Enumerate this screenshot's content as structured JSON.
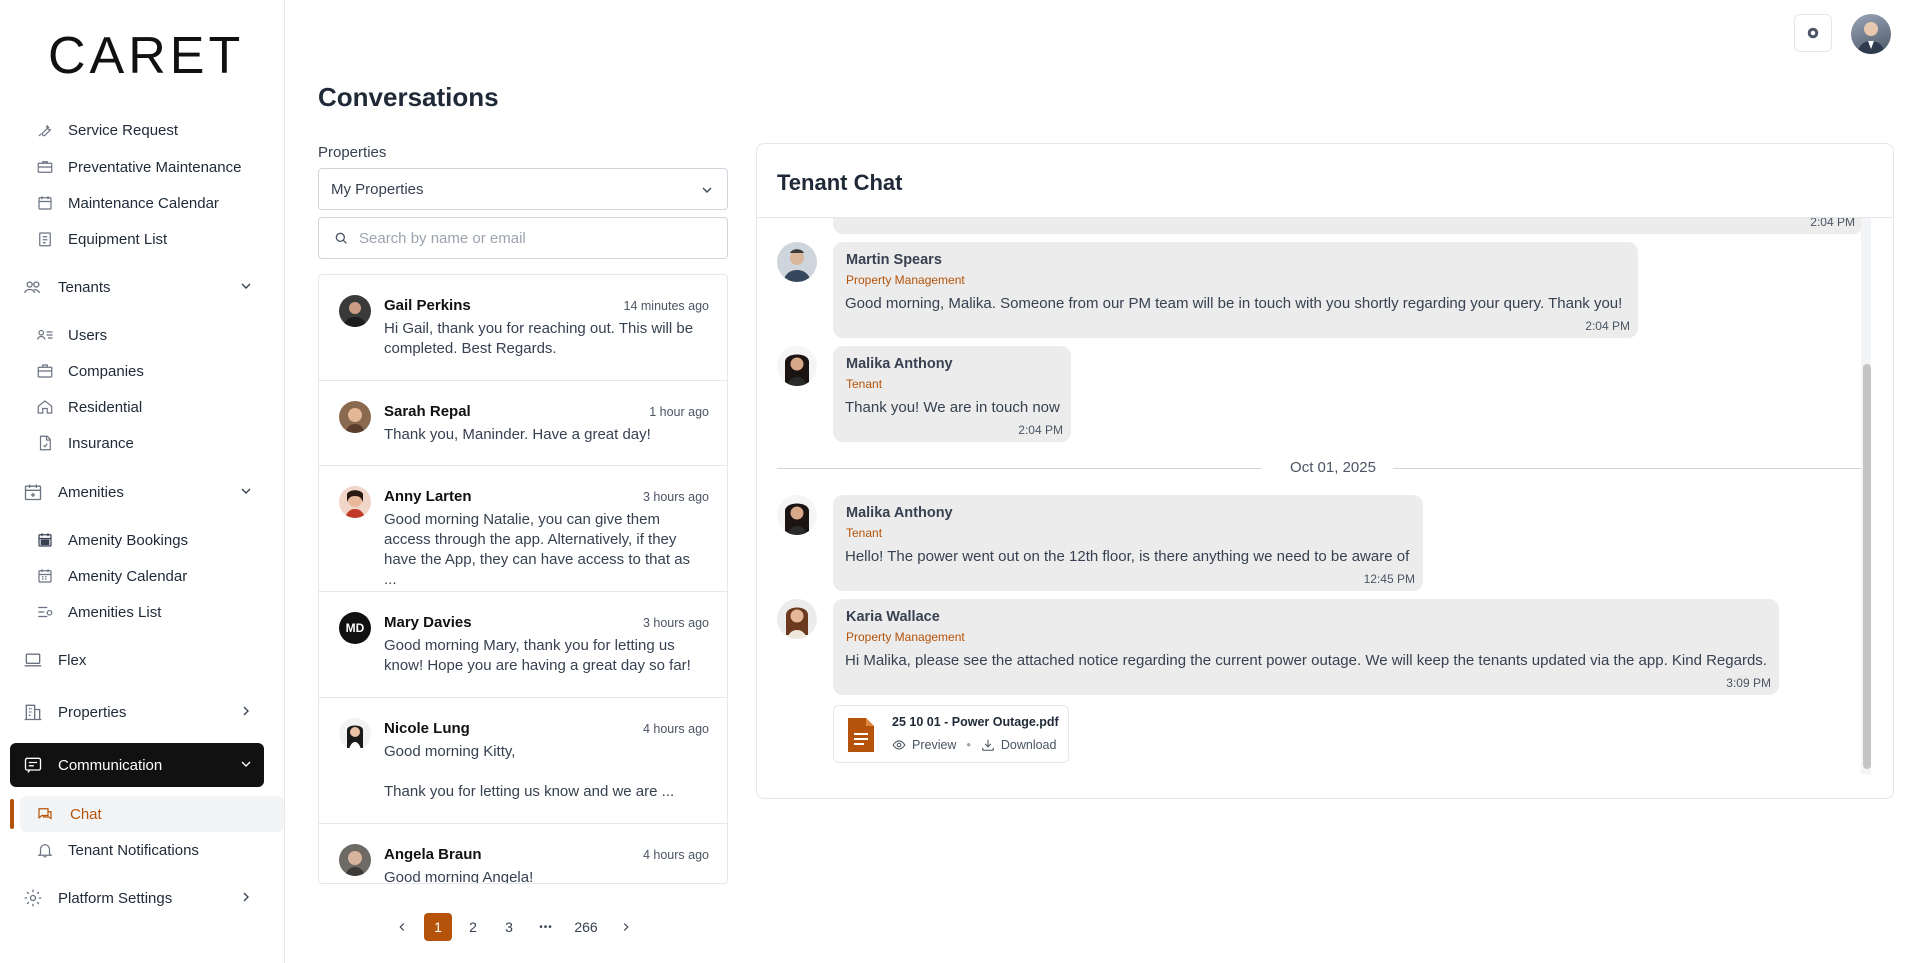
{
  "app": {
    "logo": "CARET"
  },
  "sidebar": {
    "top_items": [
      {
        "label": "Service Request",
        "icon": "wrench-icon"
      },
      {
        "label": "Preventative Maintenance",
        "icon": "toolbox-icon"
      },
      {
        "label": "Maintenance Calendar",
        "icon": "calendar-icon"
      },
      {
        "label": "Equipment List",
        "icon": "clipboard-icon"
      }
    ],
    "tenants": {
      "label": "Tenants",
      "icon": "people-icon"
    },
    "tenant_items": [
      {
        "label": "Users",
        "icon": "user-list-icon"
      },
      {
        "label": "Companies",
        "icon": "briefcase-icon"
      },
      {
        "label": "Residential",
        "icon": "home-icon"
      },
      {
        "label": "Insurance",
        "icon": "document-icon"
      }
    ],
    "amenities": {
      "label": "Amenities",
      "icon": "calendar-plus-icon"
    },
    "amenity_items": [
      {
        "label": "Amenity Bookings",
        "icon": "calendar-check-icon"
      },
      {
        "label": "Amenity Calendar",
        "icon": "calendar-grid-icon"
      },
      {
        "label": "Amenities List",
        "icon": "list-icon"
      }
    ],
    "flex": {
      "label": "Flex",
      "icon": "laptop-icon"
    },
    "properties": {
      "label": "Properties",
      "icon": "building-icon"
    },
    "communication": {
      "label": "Communication",
      "icon": "chat-box-icon"
    },
    "communication_items": [
      {
        "label": "Chat",
        "icon": "chat-icon"
      },
      {
        "label": "Tenant Notifications",
        "icon": "bell-icon"
      }
    ],
    "platform_settings": {
      "label": "Platform Settings",
      "icon": "gear-icon"
    }
  },
  "header": {
    "title": "Conversations"
  },
  "filters": {
    "properties_label": "Properties",
    "properties_value": "My Properties",
    "search_placeholder": "Search by name or email"
  },
  "conversations": [
    {
      "name": "Gail Perkins",
      "time": "14 minutes ago",
      "message": "Hi Gail, thank you for reaching out. This will be completed. Best Regards."
    },
    {
      "name": "Sarah Repal",
      "time": "1 hour ago",
      "message": "Thank you, Maninder.  Have a great day!"
    },
    {
      "name": "Anny Larten",
      "time": "3 hours ago",
      "message": "Good morning Natalie, you can give them access through the app. Alternatively, if they have the App, they can have access to that as ..."
    },
    {
      "name": "Mary Davies",
      "time": "3 hours ago",
      "message": "Good morning Mary, thank you for letting us know! Hope you are having a great day so far!",
      "initials": "MD"
    },
    {
      "name": "Nicole Lung",
      "time": "4 hours ago",
      "message": "Good morning Kitty,\n\nThank you for letting us know and we are ..."
    },
    {
      "name": "Angela Braun",
      "time": "4 hours ago",
      "message": "Good morning Angela!"
    }
  ],
  "pagination": {
    "pages": [
      "1",
      "2",
      "3"
    ],
    "ellipsis": "•••",
    "last": "266",
    "current": "1"
  },
  "chat": {
    "title": "Tenant Chat",
    "prev_time": "2:04 PM",
    "date_separator": "Oct 01, 2025",
    "messages": [
      {
        "name": "Martin Spears",
        "role": "Property Management",
        "text": "Good morning, Malika. Someone from our PM team will be in touch with you shortly regarding your query. Thank you!",
        "time": "2:04 PM"
      },
      {
        "name": "Malika Anthony",
        "role": "Tenant",
        "text": "Thank you! We are in touch now",
        "time": "2:04 PM"
      },
      {
        "name": "Malika Anthony",
        "role": "Tenant",
        "text": "Hello! The power went out on the 12th floor, is there anything we need to be aware of",
        "time": "12:45 PM"
      },
      {
        "name": "Karia Wallace",
        "role": "Property Management",
        "text": "Hi Malika, please see the attached notice regarding the current power outage. We will keep the tenants updated via the app. Kind Regards.",
        "time": "3:09 PM"
      }
    ],
    "attachment": {
      "filename": "25 10 01 - Power Outage.pdf",
      "preview": "Preview",
      "download": "Download"
    }
  },
  "colors": {
    "accent": "#b45309",
    "active_nav": "#111111"
  }
}
